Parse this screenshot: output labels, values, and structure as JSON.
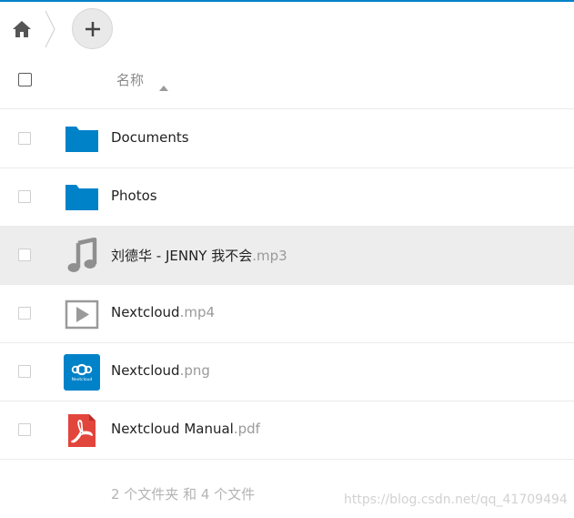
{
  "colors": {
    "accent": "#0082c9",
    "folder": "#0082c9",
    "pdf": "#e2453c",
    "hover_row": "#ededed"
  },
  "breadcrumb": {
    "home_icon": "home-icon",
    "add_icon": "plus-icon"
  },
  "header": {
    "column_name": "名称",
    "sort_icon": "sort-ascending-icon"
  },
  "files": [
    {
      "name": "Documents",
      "ext": "",
      "icon": "folder-icon"
    },
    {
      "name": "Photos",
      "ext": "",
      "icon": "folder-icon"
    },
    {
      "name": "刘德华 - JENNY 我不会",
      "ext": ".mp3",
      "icon": "music-file-icon"
    },
    {
      "name": "Nextcloud",
      "ext": ".mp4",
      "icon": "video-file-icon"
    },
    {
      "name": "Nextcloud",
      "ext": ".png",
      "icon": "nextcloud-image-thumbnail"
    },
    {
      "name": "Nextcloud Manual",
      "ext": ".pdf",
      "icon": "pdf-file-icon"
    }
  ],
  "thumbnail_text": "Nextcloud",
  "summary": "2 个文件夹 和 4 个文件",
  "watermark": "https://blog.csdn.net/qq_41709494"
}
